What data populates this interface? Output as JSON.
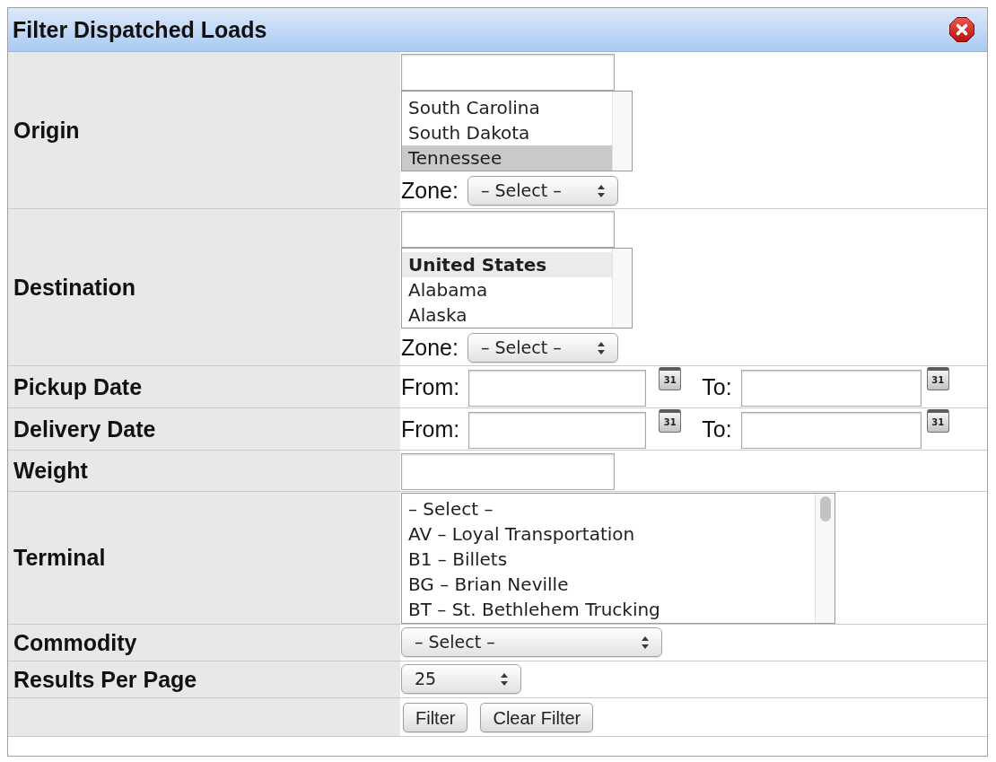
{
  "window": {
    "title": "Filter Dispatched Loads"
  },
  "fields": [
    {
      "kind": "location",
      "label": "Origin",
      "options": [
        {
          "label": "South Carolina",
          "kind": "option",
          "selected": false
        },
        {
          "label": "South Dakota",
          "kind": "option",
          "selected": false
        },
        {
          "label": "Tennessee",
          "kind": "option",
          "selected": true
        }
      ],
      "zone": {
        "label": "Zone:",
        "value": "– Select –"
      }
    },
    {
      "kind": "location",
      "label": "Destination",
      "options": [
        {
          "label": "United States",
          "kind": "group",
          "selected": false
        },
        {
          "label": "Alabama",
          "kind": "option",
          "selected": false
        },
        {
          "label": "Alaska",
          "kind": "option",
          "selected": false
        }
      ],
      "zone": {
        "label": "Zone:",
        "value": "– Select –"
      }
    },
    {
      "kind": "date_range",
      "label": "Pickup Date",
      "from": {
        "label": "From:",
        "picker": "31"
      },
      "to": {
        "label": "To:",
        "picker": "31"
      }
    },
    {
      "kind": "date_range",
      "label": "Delivery Date",
      "from": {
        "label": "From:",
        "picker": "31"
      },
      "to": {
        "label": "To:",
        "picker": "31"
      }
    },
    {
      "kind": "text",
      "label": "Weight"
    },
    {
      "kind": "list",
      "label": "Terminal",
      "options": [
        {
          "label": "– Select –",
          "kind": "option",
          "selected": false
        },
        {
          "label": "AV – Loyal Transportation",
          "kind": "option",
          "selected": false
        },
        {
          "label": "B1 – Billets",
          "kind": "option",
          "selected": false
        },
        {
          "label": "BG – Brian Neville",
          "kind": "option",
          "selected": false
        },
        {
          "label": "BT – St. Bethlehem Trucking",
          "kind": "option",
          "selected": false
        }
      ]
    },
    {
      "kind": "select",
      "label": "Commodity",
      "value": "– Select –"
    },
    {
      "kind": "select",
      "label": "Results Per Page",
      "value": "25"
    },
    {
      "kind": "actions",
      "buttons": [
        "Filter",
        "Clear Filter"
      ]
    }
  ]
}
